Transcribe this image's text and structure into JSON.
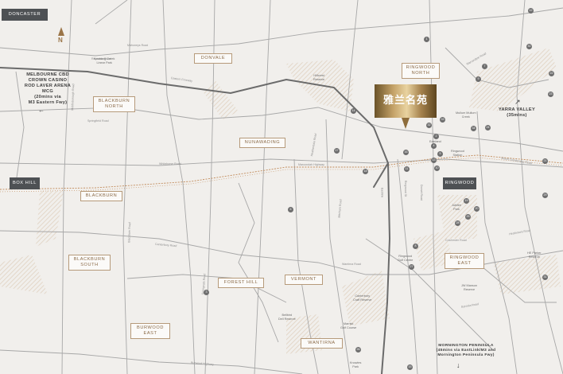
{
  "colors": {
    "background": "#f1efec",
    "roads_major": "#6b6b6b",
    "roads_minor": "#a7a7a7",
    "rail": "#c28b5a",
    "accent_gold": "#b69a7a",
    "dark_box": "#4e5154"
  },
  "north_label": "N",
  "pin": {
    "label": "雅兰名苑"
  },
  "suburbs": {
    "doncaster": "DONCASTER",
    "box_hill": "BOX HILL",
    "ringwood": "RINGWOOD",
    "donvale": "DONVALE",
    "ringwood_north": "RINGWOOD\nNORTH",
    "blackburn_north": "BLACKBURN\nNORTH",
    "nunawading": "NUNAWADING",
    "blackburn": "BLACKBURN",
    "blackburn_south": "BLACKBURN\nSOUTH",
    "forest_hill": "FOREST HILL",
    "vermont": "VERMONT",
    "ringwood_east": "RINGWOOD\nEAST",
    "burwood_east": "BURWOOD\nEAST",
    "wantirna": "WANTIRNA"
  },
  "destinations": {
    "melbourne_cbd": "MELBOURNE CBD\nCROWN CASINO\nROD LAVER ARENA\nMCG\n(20mins via\nM3 Eastern Fwy)",
    "yarra_valley": "YARRA VALLEY\n(35mins)",
    "mornington": "MORNINGTON PENINSULA\n(45mins via EastLink/M3 and\nMornington Peninsula Fwy)"
  },
  "roads": [
    "Eastern Freeway",
    "Eastlink",
    "Maroondah Highway",
    "Whitehorse Road",
    "Canterbury Road",
    "Springvale Road",
    "Mitcham Road",
    "Heatherdale Road",
    "Burwood Highway",
    "Boronia Road",
    "Wantirna Road",
    "Ringwood St",
    "Warrandyte Road",
    "Mount Dandenong Road",
    "Reynolds Road",
    "Middleborough Road",
    "Blackburn Road",
    "Mahoneys Road",
    "Nunawading",
    "Ringwood Bypass",
    "Springfield Road",
    "Koonung Creek Linear Park",
    "Colchester Road",
    "Heathmont Road",
    "Dorset Road",
    "Wantirna"
  ],
  "places": [
    "Koonung Creek\nLinear Park",
    "Hillcrest\nReserve",
    "Mullum Mullum\nCreek",
    "Eastland",
    "Ringwood\nStation",
    "Jubilee\nPark",
    "Ringwood\nGolf Centre",
    "HE Parker\nReserve",
    "JW Manson\nReserve",
    "Canterbury\nCraft Reserve",
    "Bellbird\nDell Reserve",
    "Marrisk\nGolf Course",
    "Knowles\nPark"
  ],
  "poi_numbers": [
    "1",
    "2",
    "3",
    "4",
    "5",
    "6",
    "7",
    "8",
    "9",
    "10",
    "11",
    "12",
    "13",
    "14",
    "15",
    "16",
    "17",
    "18",
    "19",
    "20",
    "21",
    "22",
    "23",
    "24",
    "25",
    "26",
    "27",
    "28",
    "29",
    "30",
    "31",
    "32",
    "33",
    "34"
  ]
}
